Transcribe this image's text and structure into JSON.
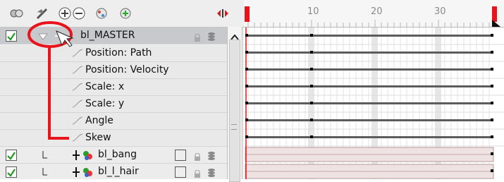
{
  "toolbar": {
    "icons": [
      "onion-skin-icon",
      "animate-mode-icon",
      "add-layer-icon",
      "remove-layer-icon",
      "add-drawing-layer-icon",
      "add-peg-icon",
      "expand-icon"
    ]
  },
  "layers": {
    "master": {
      "name": "bl_MASTER"
    },
    "functions": [
      {
        "label": "Position: Path"
      },
      {
        "label": "Position: Velocity"
      },
      {
        "label": "Scale: x"
      },
      {
        "label": "Scale: y"
      },
      {
        "label": "Angle"
      },
      {
        "label": "Skew"
      }
    ],
    "drawings": [
      {
        "name": "bl_bang"
      },
      {
        "name": "bl_l_hair"
      }
    ]
  },
  "ruler": {
    "ticks": [
      "10",
      "20",
      "30"
    ]
  },
  "colors": {
    "annotation": "#e8131b",
    "playhead": "#e8131b"
  }
}
